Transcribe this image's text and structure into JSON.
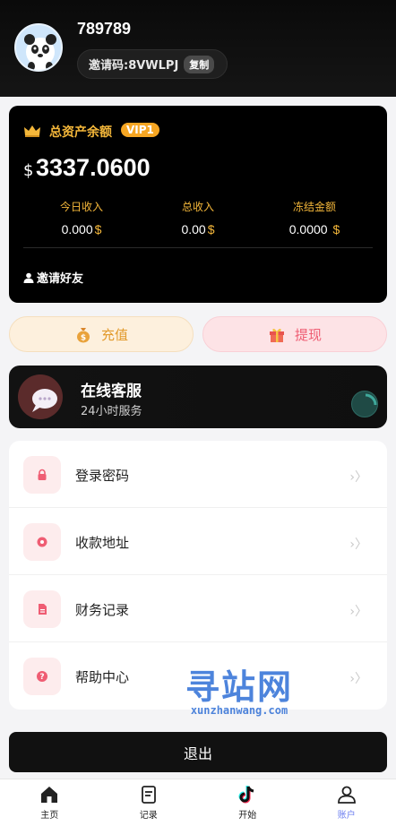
{
  "user": {
    "name": "789789",
    "invite_code_text": "邀请码:8VWLPJ",
    "copy_label": "复制"
  },
  "assets": {
    "title": "总资产余额",
    "vip_label": "VIP1",
    "currency_symbol": "$",
    "balance": "3337.0600",
    "stats": [
      {
        "label": "今日收入",
        "value": "0.000",
        "unit": "$"
      },
      {
        "label": "总收入",
        "value": "0.00",
        "unit": "$"
      },
      {
        "label": "冻结金额",
        "value": "0.0000",
        "unit": "$"
      }
    ],
    "invite_friends_label": "邀请好友"
  },
  "actions": {
    "recharge_label": "充值",
    "withdraw_label": "提现"
  },
  "support": {
    "title": "在线客服",
    "subtitle": "24小时服务"
  },
  "menu": {
    "items": [
      {
        "label": "登录密码",
        "icon": "lock-icon"
      },
      {
        "label": "收款地址",
        "icon": "address-icon"
      },
      {
        "label": "财务记录",
        "icon": "document-icon"
      },
      {
        "label": "帮助中心",
        "icon": "help-icon"
      }
    ]
  },
  "watermark": {
    "big": "寻站网",
    "small": "xunzhanwang.com"
  },
  "logout_label": "退出",
  "nav": {
    "items": [
      {
        "label": "主页",
        "icon": "home-icon"
      },
      {
        "label": "记录",
        "icon": "records-icon"
      },
      {
        "label": "开始",
        "icon": "tiktok-icon"
      },
      {
        "label": "账户",
        "icon": "account-icon"
      }
    ],
    "active_index": 3
  },
  "colors": {
    "accent_gold": "#f4b73a",
    "vip_orange": "#f6a623",
    "withdraw_pink": "#ef5d73",
    "nav_active": "#6d7ff0"
  }
}
